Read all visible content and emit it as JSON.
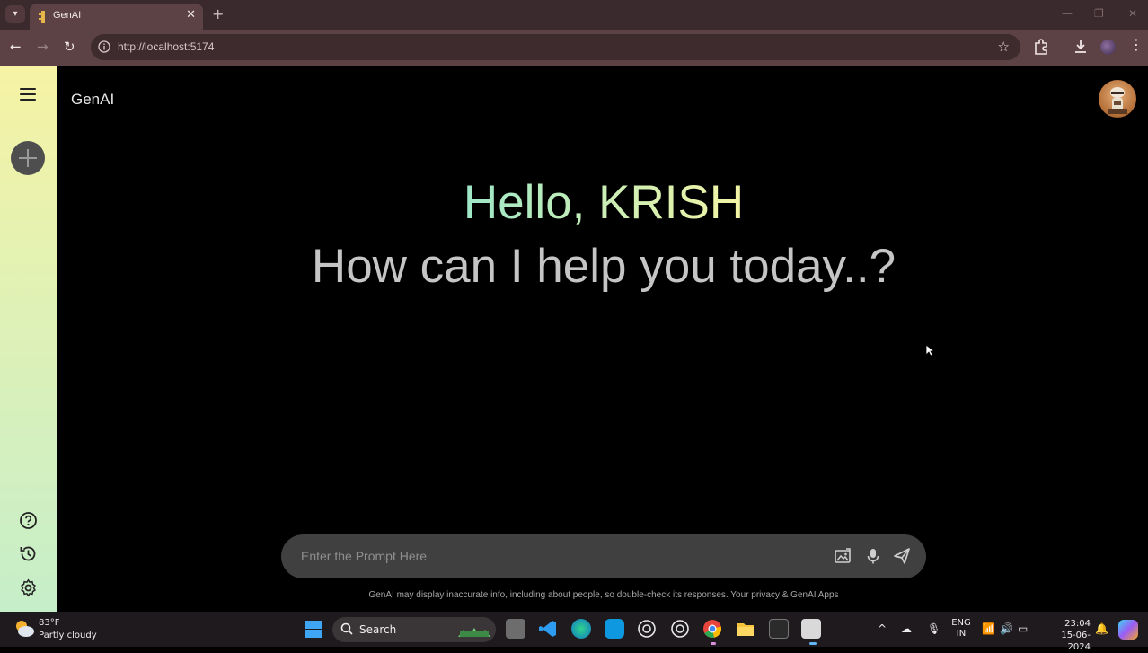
{
  "browser": {
    "tab_title": "GenAI",
    "url": "http://localhost:5174",
    "icons": [
      "tab-list-icon",
      "favicon",
      "close-tab-icon",
      "new-tab-icon",
      "back-icon",
      "forward-icon",
      "reload-icon",
      "site-info-icon",
      "bookmark-star-icon",
      "extensions-icon",
      "download-icon",
      "profile-icon",
      "menu-icon"
    ]
  },
  "app": {
    "brand": "GenAI",
    "greeting": "Hello, KRISH",
    "subtitle": "How can I help you today..?",
    "prompt_placeholder": "Enter the Prompt Here",
    "prompt_value": "",
    "disclaimer": "GenAI may display inaccurate info, including about people, so double-check its responses. Your privacy & GenAI Apps",
    "sidebar_icons": [
      "menu-icon",
      "new-chat-icon",
      "help-icon",
      "history-icon",
      "settings-icon"
    ],
    "prompt_icons": [
      "gallery-icon",
      "mic-icon",
      "send-icon"
    ],
    "colors": {
      "sidebar_top": "#f6f3a4",
      "sidebar_bottom": "#c6eec9",
      "greeting_start": "#9ee7c8",
      "greeting_end": "#f4f5a4",
      "prompt_bg": "#404040"
    }
  },
  "taskbar": {
    "weather_temp": "83°F",
    "weather_desc": "Partly cloudy",
    "search_label": "Search",
    "lang_line1": "ENG",
    "lang_line2": "IN",
    "time": "23:04",
    "date": "15-06-2024"
  }
}
